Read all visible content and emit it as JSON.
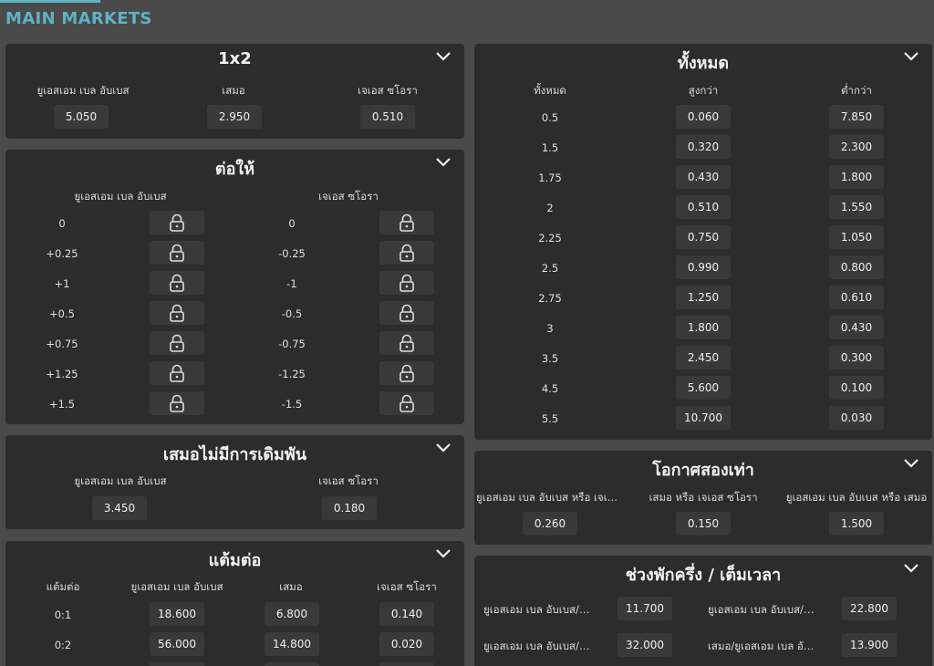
{
  "header": {
    "title": "MAIN MARKETS"
  },
  "one_x_two": {
    "title": "1x2",
    "options": [
      {
        "label": "ยูเอสเอม เบล อับเบส",
        "odds": "5.050"
      },
      {
        "label": "เสมอ",
        "odds": "2.950"
      },
      {
        "label": "เจเอส ซโอรา",
        "odds": "0.510"
      }
    ]
  },
  "handicap": {
    "title": "ต่อให้",
    "home_label": "ยูเอสเอม เบล อับเบส",
    "away_label": "เจเอส ซโอรา",
    "rows": [
      {
        "home": "0",
        "away": "0"
      },
      {
        "home": "+0.25",
        "away": "-0.25"
      },
      {
        "home": "+1",
        "away": "-1"
      },
      {
        "home": "+0.5",
        "away": "-0.5"
      },
      {
        "home": "+0.75",
        "away": "-0.75"
      },
      {
        "home": "+1.25",
        "away": "-1.25"
      },
      {
        "home": "+1.5",
        "away": "-1.5"
      }
    ]
  },
  "draw_no_bet": {
    "title": "เสมอไม่มีการเดิมพัน",
    "options": [
      {
        "label": "ยูเอสเอม เบล อับเบส",
        "odds": "3.450"
      },
      {
        "label": "เจเอส ซโอรา",
        "odds": "0.180"
      }
    ]
  },
  "correct_score": {
    "title": "แต้มต่อ",
    "headers": [
      "แต้มต่อ",
      "ยูเอสเอม เบล อับเบส",
      "เสมอ",
      "เจเอส ซโอรา"
    ],
    "rows": [
      {
        "score": "0:1",
        "home": "18.600",
        "draw": "6.800",
        "away": "0.140"
      },
      {
        "score": "0:2",
        "home": "56.000",
        "draw": "14.800",
        "away": "0.020"
      }
    ]
  },
  "totals": {
    "title": "ทั้งหมด",
    "headers": [
      "ทั้งหมด",
      "สูงกว่า",
      "ต่ำกว่า"
    ],
    "rows": [
      {
        "line": "0.5",
        "over": "0.060",
        "under": "7.850"
      },
      {
        "line": "1.5",
        "over": "0.320",
        "under": "2.300"
      },
      {
        "line": "1.75",
        "over": "0.430",
        "under": "1.800"
      },
      {
        "line": "2",
        "over": "0.510",
        "under": "1.550"
      },
      {
        "line": "2.25",
        "over": "0.750",
        "under": "1.050"
      },
      {
        "line": "2.5",
        "over": "0.990",
        "under": "0.800"
      },
      {
        "line": "2.75",
        "over": "1.250",
        "under": "0.610"
      },
      {
        "line": "3",
        "over": "1.800",
        "under": "0.430"
      },
      {
        "line": "3.5",
        "over": "2.450",
        "under": "0.300"
      },
      {
        "line": "4.5",
        "over": "5.600",
        "under": "0.100"
      },
      {
        "line": "5.5",
        "over": "10.700",
        "under": "0.030"
      }
    ]
  },
  "double_chance": {
    "title": "โอกาศสองเท่า",
    "options": [
      {
        "label": "ยูเอสเอม เบล อับเบส หรือ เจเอส ซโอรา",
        "odds": "0.260"
      },
      {
        "label": "เสมอ หรือ เจเอส ซโอรา",
        "odds": "0.150"
      },
      {
        "label": "ยูเอสเอม เบล อับเบส หรือ เสมอ",
        "odds": "1.500"
      }
    ]
  },
  "ht_ft": {
    "title": "ช่วงพักครึ่ง / เต็มเวลา",
    "rows": [
      {
        "left_label": "ยูเอสเอม เบล อับเบส/ยูเอสเอม เบล อับเบส",
        "left_odds": "11.700",
        "right_label": "ยูเอสเอม เบล อับเบส/เสมอ",
        "right_odds": "22.800"
      },
      {
        "left_label": "ยูเอสเอม เบล อับเบส/เจเอส ซโอรา",
        "left_odds": "32.000",
        "right_label": "เสมอ/ยูเอสเอม เบล อับเบส",
        "right_odds": "13.900"
      }
    ]
  },
  "icons": {
    "collapse": "chevron-down-icon",
    "lock": "lock-icon"
  },
  "colors": {
    "accent": "#5fb3c4",
    "panel": "#2c2c2c",
    "button": "#393939",
    "background": "#4a4a4a"
  }
}
